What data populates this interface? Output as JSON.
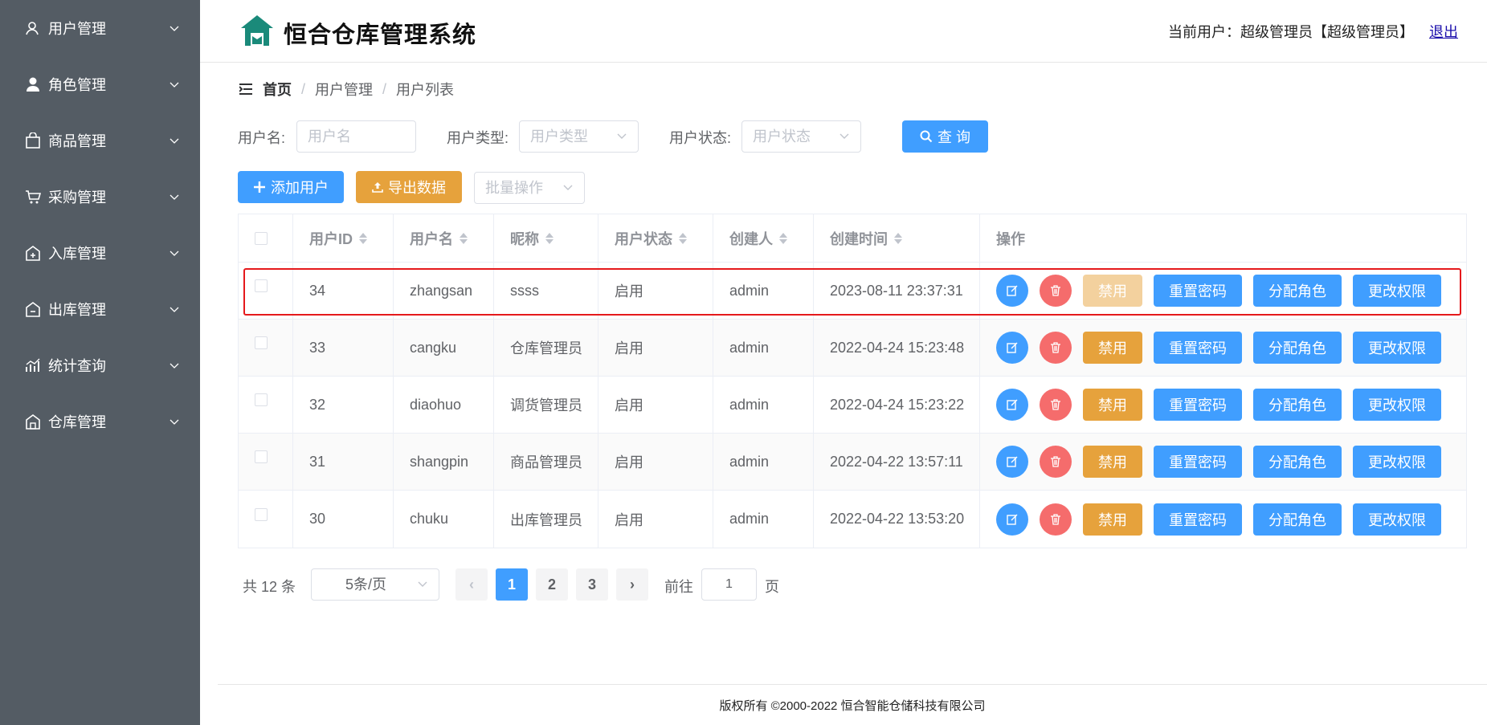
{
  "sidebar": {
    "items": [
      {
        "label": "用户管理"
      },
      {
        "label": "角色管理"
      },
      {
        "label": "商品管理"
      },
      {
        "label": "采购管理"
      },
      {
        "label": "入库管理"
      },
      {
        "label": "出库管理"
      },
      {
        "label": "统计查询"
      },
      {
        "label": "仓库管理"
      }
    ]
  },
  "header": {
    "title": "恒合仓库管理系统",
    "current_user": "当前用户：超级管理员【超级管理员】",
    "logout": "退出"
  },
  "breadcrumb": [
    "首页",
    "用户管理",
    "用户列表"
  ],
  "search": {
    "username_label": "用户名:",
    "username_placeholder": "用户名",
    "type_label": "用户类型:",
    "type_placeholder": "用户类型",
    "status_label": "用户状态:",
    "status_placeholder": "用户状态",
    "query_button": "查 询"
  },
  "toolbar": {
    "add_user": "添加用户",
    "export": "导出数据",
    "batch_placeholder": "批量操作"
  },
  "table": {
    "headers": [
      "用户ID",
      "用户名",
      "昵称",
      "用户状态",
      "创建人",
      "创建时间",
      "操作"
    ],
    "rows": [
      {
        "id": "34",
        "username": "zhangsan",
        "nickname": "ssss",
        "status": "启用",
        "creator": "admin",
        "created": "2023-08-11 23:37:31"
      },
      {
        "id": "33",
        "username": "cangku",
        "nickname": "仓库管理员",
        "status": "启用",
        "creator": "admin",
        "created": "2022-04-24 15:23:48"
      },
      {
        "id": "32",
        "username": "diaohuo",
        "nickname": "调货管理员",
        "status": "启用",
        "creator": "admin",
        "created": "2022-04-24 15:23:22"
      },
      {
        "id": "31",
        "username": "shangpin",
        "nickname": "商品管理员",
        "status": "启用",
        "creator": "admin",
        "created": "2022-04-22 13:57:11"
      },
      {
        "id": "30",
        "username": "chuku",
        "nickname": "出库管理员",
        "status": "启用",
        "creator": "admin",
        "created": "2022-04-22 13:53:20"
      }
    ],
    "actions": {
      "disable": "禁用",
      "reset_password": "重置密码",
      "assign_role": "分配角色",
      "change_permission": "更改权限"
    }
  },
  "pagination": {
    "total": "共 12 条",
    "page_size": "5条/页",
    "pages": [
      "1",
      "2",
      "3"
    ],
    "current_page": "1",
    "goto_label": "前往",
    "goto_value": "1",
    "goto_suffix": "页"
  },
  "footer": {
    "copyright": "版权所有 ©2000-2022  恒合智能仓储科技有限公司"
  },
  "colors": {
    "sidebar_bg": "#545c64",
    "primary": "#409eff",
    "warning": "#e6a23c",
    "danger": "#f56c6c",
    "highlight": "#e5191c",
    "logo": "#1a8a7a"
  }
}
